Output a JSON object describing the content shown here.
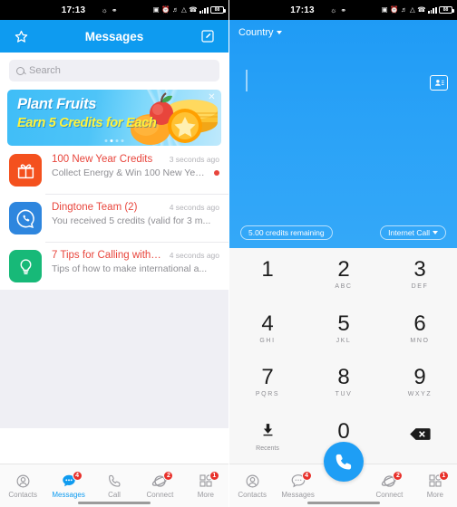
{
  "status_bar": {
    "time": "17:13",
    "left_icons": [
      "person-walking-icon",
      "binoculars-icon"
    ],
    "right_icons": [
      "nfc-icon",
      "alarm-icon",
      "mute-icon",
      "wifi-icon",
      "vpn-icon",
      "signal-icon"
    ],
    "battery_level": "88"
  },
  "colors": {
    "brand_blue": "#0e9bf0",
    "dial_blue": "#2aa2f7",
    "accent_red": "#e8453c",
    "badge_red": "#e8302a",
    "banner_yellow": "#fff33d"
  },
  "left_screen": {
    "navbar": {
      "title": "Messages",
      "left_icon": "star-icon",
      "right_icon": "compose-icon"
    },
    "search": {
      "placeholder": "Search",
      "icon": "search-icon"
    },
    "banner": {
      "line1": "Plant Fruits",
      "line2": "Earn 5 Credits for Each",
      "close_icon": "close-icon",
      "dots_total": 4,
      "dot_active_index": 1
    },
    "messages": [
      {
        "icon": "gift-icon",
        "title": "100 New Year Credits",
        "time": "3 seconds ago",
        "preview": "Collect Energy & Win 100 New Year...",
        "unread": true
      },
      {
        "icon": "dingtone-chat-icon",
        "title": "Dingtone Team (2)",
        "time": "4 seconds ago",
        "preview": "You received 5 credits (valid for 3 m...",
        "unread": false
      },
      {
        "icon": "lightbulb-icon",
        "title": "7 Tips for Calling with Di...",
        "time": "4 seconds ago",
        "preview": "Tips of how to make international a...",
        "unread": false
      }
    ],
    "tabs": [
      {
        "label": "Contacts",
        "icon": "contacts-icon",
        "badge": "",
        "active": false
      },
      {
        "label": "Messages",
        "icon": "messages-icon",
        "badge": "4",
        "active": true
      },
      {
        "label": "Call",
        "icon": "phone-icon",
        "badge": "",
        "active": false
      },
      {
        "label": "Connect",
        "icon": "connect-icon",
        "badge": "2",
        "active": false
      },
      {
        "label": "More",
        "icon": "grid-more-icon",
        "badge": "1",
        "active": false
      }
    ]
  },
  "right_screen": {
    "country_selector": "Country",
    "country_caret": "chevron-down-icon",
    "contacts_button_icon": "contact-card-icon",
    "credits_pill": "5.00 credits remaining",
    "call_type_pill": "Internet Call",
    "call_type_caret": "chevron-down-icon",
    "dialed_number": "",
    "keypad": [
      {
        "num": "1",
        "sub": ""
      },
      {
        "num": "2",
        "sub": "ABC"
      },
      {
        "num": "3",
        "sub": "DEF"
      },
      {
        "num": "4",
        "sub": "GHI"
      },
      {
        "num": "5",
        "sub": "JKL"
      },
      {
        "num": "6",
        "sub": "MNO"
      },
      {
        "num": "7",
        "sub": "PQRS"
      },
      {
        "num": "8",
        "sub": "TUV"
      },
      {
        "num": "9",
        "sub": "WXYZ"
      }
    ],
    "recents_label": "Recents",
    "recents_icon": "download-recents-icon",
    "zero_key": {
      "num": "0",
      "sub": "+"
    },
    "delete_icon": "backspace-icon",
    "call_button_icon": "phone-icon",
    "tabs": [
      {
        "label": "Contacts",
        "icon": "contacts-icon",
        "badge": "",
        "active": false
      },
      {
        "label": "Messages",
        "icon": "messages-icon",
        "badge": "4",
        "active": false
      },
      {
        "label": "Connect",
        "icon": "connect-icon",
        "badge": "2",
        "active": false
      },
      {
        "label": "More",
        "icon": "grid-more-icon",
        "badge": "1",
        "active": false
      }
    ]
  }
}
